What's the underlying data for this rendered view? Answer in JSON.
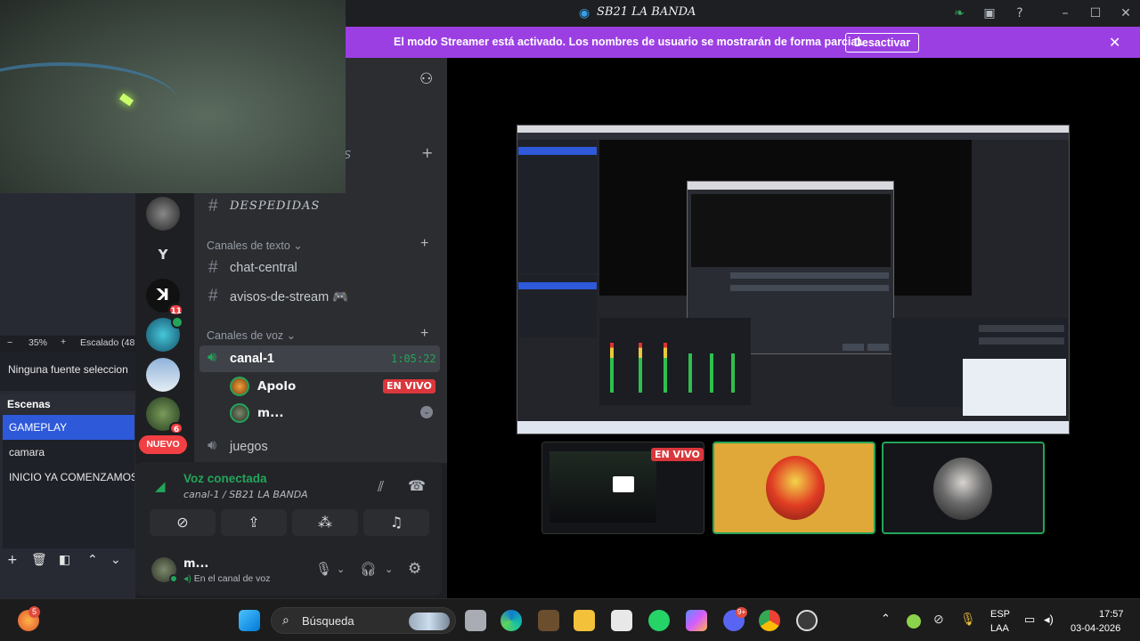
{
  "window": {
    "title": "SB21 LA BANDA"
  },
  "banner": {
    "message": "El modo Streamer está activado. Los nombres de usuario se mostrarán de forma parcial.",
    "button": "Desactivar",
    "bg": "#9b3fe3"
  },
  "obs": {
    "zoom": "35%",
    "scaling": "Escalado (48",
    "no_source": "Ninguna fuente seleccion",
    "scenes_title": "Escenas",
    "scenes": [
      "GAMEPLAY",
      "camara",
      "INICIO YA COMENZAMOS"
    ],
    "selected_scene": "GAMEPLAY"
  },
  "rail": {
    "letter_server": "Y",
    "badges": [
      "11",
      "6"
    ],
    "new_label": "NUEVO"
  },
  "channels": {
    "category_partial": "DAS",
    "farewell": "DESPEDIDAS",
    "text_category": "Canales de texto",
    "text_channels": [
      "chat-central",
      "avisos-de-stream 🎮"
    ],
    "voice_category": "Canales de voz",
    "active_voice": "canal-1",
    "voice_timer": "1:05:22",
    "members": [
      {
        "name": "Apolo",
        "status": "EN VIVO"
      },
      {
        "name": "m..."
      }
    ],
    "other_voice": "juegos"
  },
  "voice_panel": {
    "status": "Voz conectada",
    "location": "canal-1 / SB21 LA BANDA",
    "user": "m...",
    "user_status": "En el canal de voz"
  },
  "stream": {
    "live_badge": "EN VIVO",
    "accent": "#23a55a"
  },
  "taskbar": {
    "search": "Búsqueda",
    "notif_count": "5",
    "discord_badge": "9+",
    "lang": "ESP",
    "layout": "LAA",
    "time": "17:57",
    "date": "03-04-2026"
  }
}
